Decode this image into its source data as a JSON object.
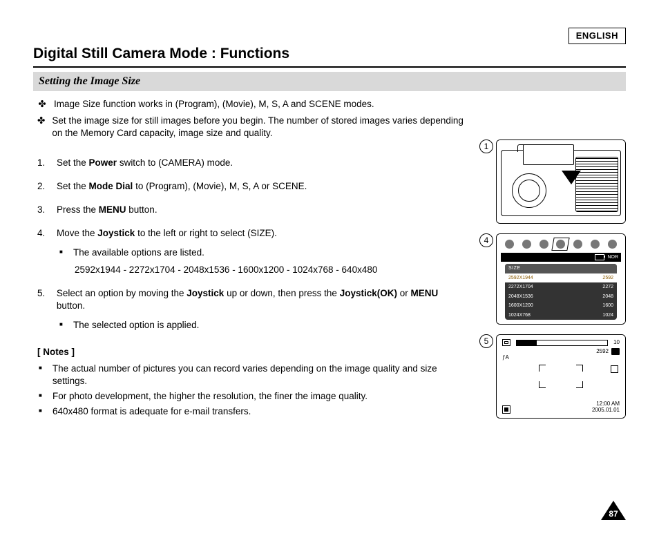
{
  "language_label": "ENGLISH",
  "title": "Digital Still Camera Mode : Functions",
  "subtitle": "Setting the Image Size",
  "intro": [
    "Image Size function works  in      (Program),       (Movie), M, S, A and SCENE modes.",
    "Set the image size for still images before you begin. The number of stored images varies depending on the Memory Card capacity, image size and quality."
  ],
  "steps": [
    {
      "n": "1.",
      "text_before": "Set the ",
      "bold": "Power",
      "text_after": " switch to      (CAMERA) mode."
    },
    {
      "n": "2.",
      "text_before": "Set the ",
      "bold": "Mode Dial",
      "text_after": " to      (Program),       (Movie), M, S, A or SCENE."
    },
    {
      "n": "3.",
      "text_before": "Press the ",
      "bold": "MENU",
      "text_after": " button."
    },
    {
      "n": "4.",
      "text_before": "Move the ",
      "bold": "Joystick",
      "text_after": " to the left or right to select        (SIZE)."
    }
  ],
  "step4_sub": "The available options are listed.",
  "step4_sizes": "2592x1944 - 2272x1704 - 2048x1536 - 1600x1200 - 1024x768 - 640x480",
  "step5": {
    "n": "5.",
    "seg1": "Select an option by moving the ",
    "b1": "Joystick",
    "seg2": " up or down, then press the ",
    "b2": "Joystick(OK)",
    "seg3": " or ",
    "b3": "MENU",
    "seg4": " button."
  },
  "step5_sub": "The selected option is applied.",
  "notes_head": "[ Notes ]",
  "notes": [
    "The actual number of pictures you can record varies depending on the image quality and size settings.",
    "For photo development, the higher the resolution, the finer the image quality.",
    "640x480 format is adequate for e-mail transfers."
  ],
  "fig_numbers": {
    "f1": "1",
    "f4": "4",
    "f5": "5"
  },
  "menu": {
    "nor": "NOR",
    "size_label": "SIZE",
    "rows": [
      {
        "res": "2592X1944",
        "short": "2592",
        "hl": true
      },
      {
        "res": "2272X1704",
        "short": "2272",
        "hl": false
      },
      {
        "res": "2048X1536",
        "short": "2048",
        "hl": false
      },
      {
        "res": "1600X1200",
        "short": "1600",
        "hl": false
      },
      {
        "res": "1024X768",
        "short": "1024",
        "hl": false
      }
    ]
  },
  "preview": {
    "count": "10",
    "res": "2592",
    "flash": "ƒA",
    "time": "12:00 AM",
    "date": "2005.01.01"
  },
  "page_number": "87"
}
